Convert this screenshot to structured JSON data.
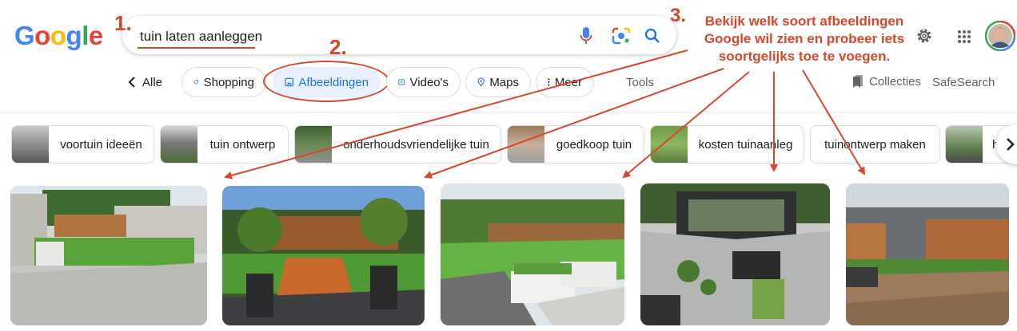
{
  "logo": {
    "letters": [
      "G",
      "o",
      "o",
      "g",
      "l",
      "e"
    ]
  },
  "search": {
    "query": "tuin laten aanleggen"
  },
  "annotations": {
    "step1": "1.",
    "step2": "2.",
    "step3": "3.",
    "step3_text_line1": "Bekijk welk soort afbeeldingen",
    "step3_text_line2": "Google wil zien en probeer iets",
    "step3_text_line3": "soortgelijks toe te voegen."
  },
  "tabs": {
    "all": "Alle",
    "shopping": "Shopping",
    "images": "Afbeeldingen",
    "videos": "Video's",
    "maps": "Maps",
    "more": "Meer",
    "tools": "Tools",
    "collections": "Collecties",
    "safesearch": "SafeSearch"
  },
  "chips": [
    {
      "label": "voortuin ideeën"
    },
    {
      "label": "tuin ontwerp"
    },
    {
      "label": "onderhoudsvriendelijke tuin"
    },
    {
      "label": "goedkoop tuin"
    },
    {
      "label": "kosten tuinaanleg"
    },
    {
      "label": "tuinontwerp maken"
    },
    {
      "label": "h"
    }
  ],
  "colors": {
    "annotation": "#d9472b",
    "google_blue": "#4285f4",
    "google_red": "#ea4335",
    "google_yellow": "#fbbc05",
    "google_green": "#34a853",
    "active_tab_bg": "#e8f0fe",
    "active_tab_text": "#1a73e8"
  },
  "icons": {
    "mic": "microphone-icon",
    "lens": "camera-lens-icon",
    "search": "search-icon",
    "settings": "gear-icon",
    "apps": "apps-grid-icon",
    "avatar": "account-avatar",
    "back": "chevron-left-icon",
    "next": "chevron-right-icon"
  }
}
